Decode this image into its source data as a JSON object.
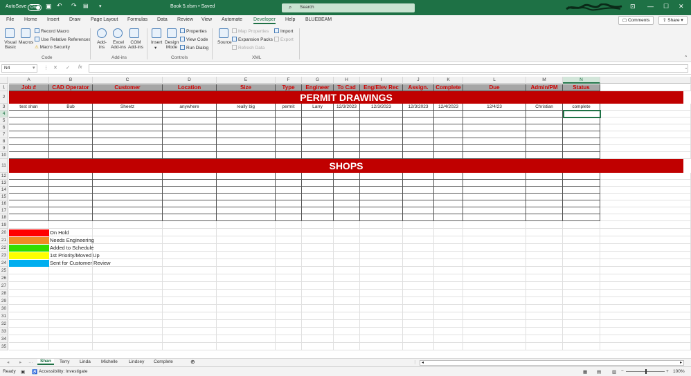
{
  "titlebar": {
    "autosave_label": "AutoSave",
    "autosave_state": "On",
    "doc_title": "Book 5.xlsm • Saved",
    "search_placeholder": "Search",
    "minimize": "—",
    "restore": "☐",
    "close": "✕",
    "accent": "#1e7145"
  },
  "ribbon_tabs": [
    "File",
    "Home",
    "Insert",
    "Draw",
    "Page Layout",
    "Formulas",
    "Data",
    "Review",
    "View",
    "Automate",
    "Developer",
    "Help",
    "BLUEBEAM"
  ],
  "ribbon_active_tab": "Developer",
  "comments_label": "Comments",
  "share_label": "Share",
  "ribbon": {
    "code": {
      "visual_basic": "Visual Basic",
      "macros": "Macros",
      "record_macro": "Record Macro",
      "use_relative": "Use Relative References",
      "macro_security": "Macro Security",
      "group": "Code"
    },
    "addins": {
      "addins": "Add-ins",
      "excel_addins": "Excel Add-ins",
      "com_addins": "COM Add-ins",
      "group": "Add-ins"
    },
    "controls": {
      "insert": "Insert",
      "design_mode": "Design Mode",
      "properties": "Properties",
      "view_code": "View Code",
      "run_dialog": "Run Dialog",
      "group": "Controls"
    },
    "xml": {
      "source": "Source",
      "map_properties": "Map Properties",
      "expansion_packs": "Expansion Packs",
      "refresh_data": "Refresh Data",
      "import": "Import",
      "export": "Export",
      "group": "XML"
    }
  },
  "formula_bar": {
    "name_box": "N4",
    "fx": "fx",
    "value": ""
  },
  "columns": [
    "A",
    "B",
    "C",
    "D",
    "E",
    "F",
    "G",
    "H",
    "I",
    "J",
    "K",
    "L",
    "M",
    "N"
  ],
  "selected_column": "N",
  "selected_row": 4,
  "header_row": [
    "Job #",
    "CAD Operator",
    "Customer",
    "Location",
    "Size",
    "Type",
    "Engineer",
    "To Cad",
    "Eng/Elev Rec",
    "Assign.",
    "Complete",
    "Due",
    "Admin/PM",
    "Status"
  ],
  "permit_banner": "PERMIT DRAWINGS",
  "shops_banner": "SHOPS",
  "data_row": [
    "test shan",
    "Bub",
    "Sheetz",
    "anywhere",
    "really big",
    "permit",
    "Larry",
    "12/3/2023",
    "12/3/2023",
    "12/3/2023",
    "12/4/2023",
    "12/4/23",
    "Christian",
    "complete"
  ],
  "row_numbers": [
    "1",
    "2",
    "3",
    "4",
    "5",
    "6",
    "7",
    "8",
    "9",
    "10",
    "11",
    "12",
    "13",
    "14",
    "15",
    "16",
    "17",
    "18",
    "19",
    "20",
    "21",
    "22",
    "23",
    "24",
    "25",
    "26",
    "27",
    "28",
    "29",
    "30",
    "31",
    "32",
    "33",
    "34",
    "35"
  ],
  "legend": [
    {
      "label": "On Hold",
      "color": "#ff0000"
    },
    {
      "label": "Needs Engineering",
      "color": "#f08a24"
    },
    {
      "label": "Added to Schedule",
      "color": "#33dd00"
    },
    {
      "label": "1st Priority/Moved Up",
      "color": "#ffff00"
    },
    {
      "label": "Sent for Customer Review",
      "color": "#00aeef"
    }
  ],
  "sheet_tabs": [
    "Shan",
    "Terry",
    "Linda",
    "Michelle",
    "Lindsey",
    "Complete"
  ],
  "active_sheet": "Shan",
  "status_bar": {
    "ready": "Ready",
    "accessibility": "Accessibility: Investigate",
    "zoom": "100%"
  },
  "colors": {
    "banner": "#c00000",
    "header_fill": "#a6a6a6",
    "header_text": "#d00000"
  }
}
